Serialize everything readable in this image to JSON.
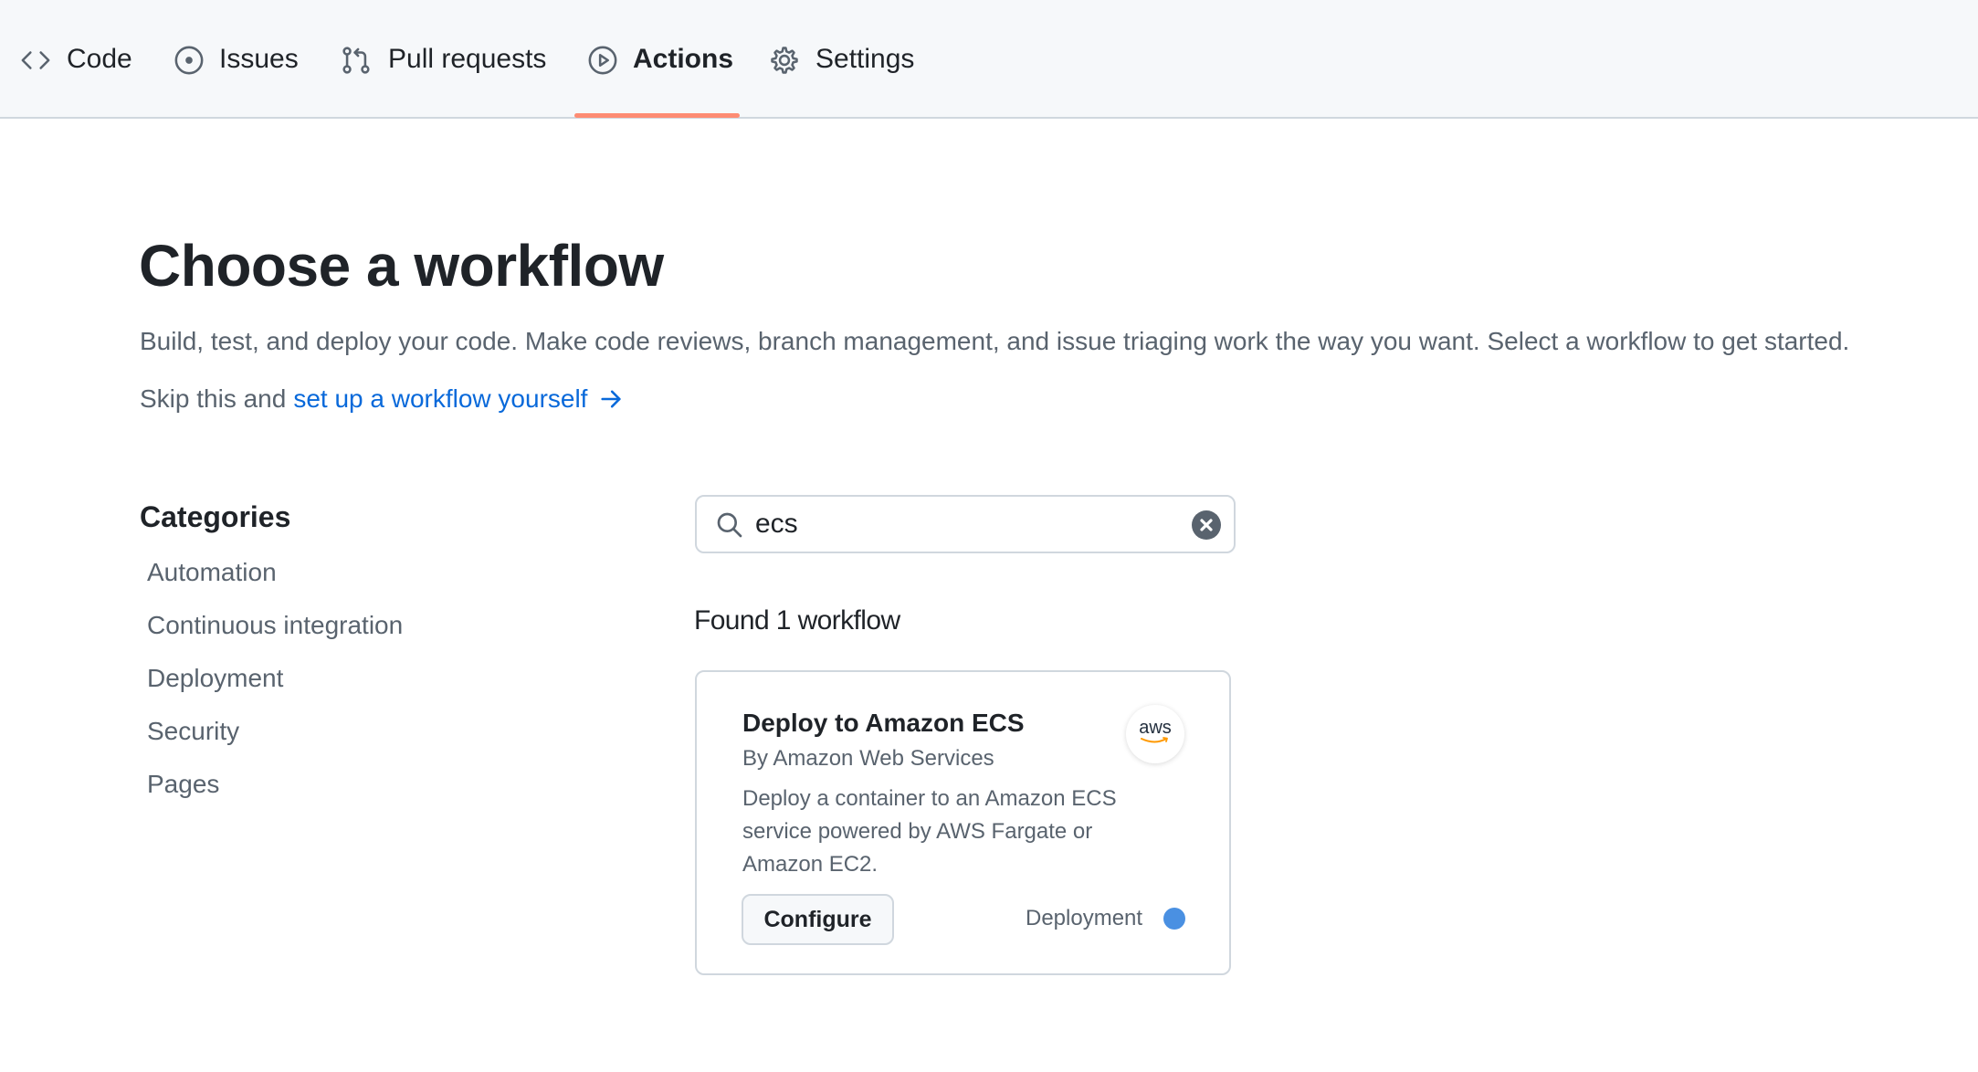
{
  "nav": {
    "tabs": [
      {
        "label": "Code",
        "icon": "code-icon"
      },
      {
        "label": "Issues",
        "icon": "issue-opened-icon"
      },
      {
        "label": "Pull requests",
        "icon": "git-pull-request-icon"
      },
      {
        "label": "Actions",
        "icon": "play-icon",
        "active": true
      },
      {
        "label": "Settings",
        "icon": "gear-icon"
      }
    ],
    "active_underline_color": "#fd8c73"
  },
  "header": {
    "title": "Choose a workflow",
    "description": "Build, test, and deploy your code. Make code reviews, branch management, and issue triaging work the way you want. Select a workflow to get started.",
    "skip_prefix": "Skip this and",
    "skip_link": "set up a workflow yourself"
  },
  "sidebar": {
    "title": "Categories",
    "items": [
      {
        "label": "Automation"
      },
      {
        "label": "Continuous integration"
      },
      {
        "label": "Deployment"
      },
      {
        "label": "Security"
      },
      {
        "label": "Pages"
      }
    ]
  },
  "search": {
    "value": "ecs",
    "icon": "search-icon",
    "clear_icon": "x-circle-fill-icon"
  },
  "results": {
    "summary": "Found 1 workflow",
    "cards": [
      {
        "title": "Deploy to Amazon ECS",
        "author": "By Amazon Web Services",
        "description": "Deploy a container to an Amazon ECS service powered by AWS Fargate or Amazon EC2.",
        "logo_text": "aws",
        "button_label": "Configure",
        "category": "Deployment",
        "category_color": "#4a90e2"
      }
    ]
  },
  "colors": {
    "link": "#0969da",
    "text": "#1f2328",
    "muted": "#59636e",
    "border": "#d0d7de",
    "nav_bg": "#f6f8fa"
  }
}
